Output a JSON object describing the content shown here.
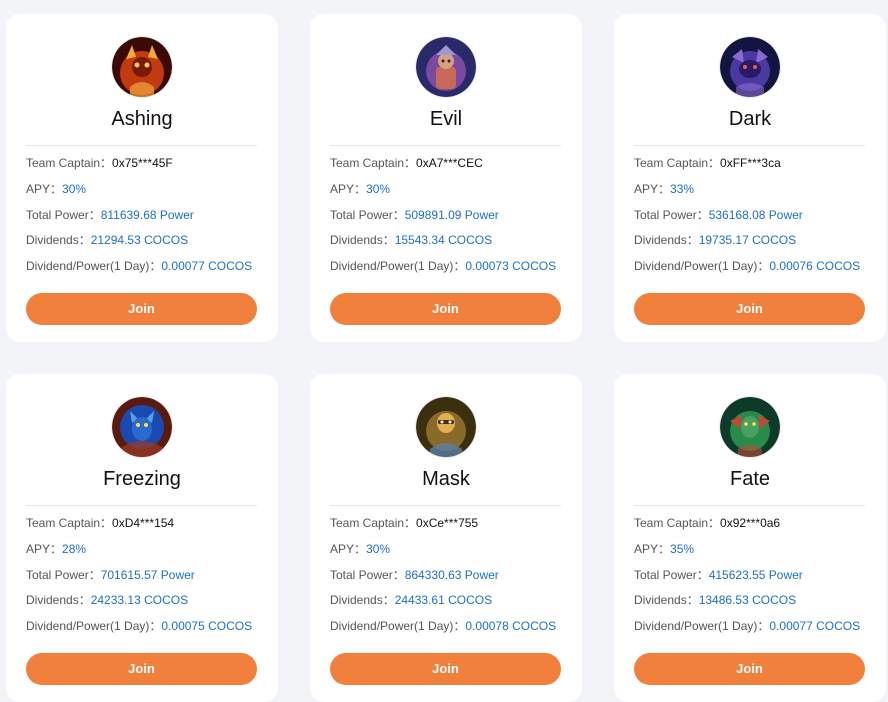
{
  "labels": {
    "captain": "Team Captain：",
    "apy": "APY：",
    "power": "Total Power：",
    "dividends": "Dividends：",
    "dividend_per_power": "Dividend/Power(1 Day)："
  },
  "colors": {
    "accent": "#f0803c",
    "value_blue": "#1f6fc4",
    "background": "#f3f4f7",
    "card": "#ffffff"
  },
  "teams": [
    {
      "name": "Ashing",
      "captain": "0x75***45F",
      "apy": "30%",
      "power": "811639.68 Power",
      "dividends": "21294.53 COCOS",
      "dividend_per_power": "0.00077 COCOS",
      "join_label": "Join",
      "avatar_icon": "fire-demon-icon",
      "avatar_colors": [
        "#3a0a05",
        "#c23a10",
        "#f2a640"
      ]
    },
    {
      "name": "Evil",
      "captain": "0xA7***CEC",
      "apy": "30%",
      "power": "509891.09 Power",
      "dividends": "15543.34 COCOS",
      "dividend_per_power": "0.00073 COCOS",
      "join_label": "Join",
      "avatar_icon": "warlord-icon",
      "avatar_colors": [
        "#2a2a6a",
        "#7a4aa0",
        "#c86a5a"
      ]
    },
    {
      "name": "Dark",
      "captain": "0xFF***3ca",
      "apy": "33%",
      "power": "536168.08 Power",
      "dividends": "19735.17 COCOS",
      "dividend_per_power": "0.00076 COCOS",
      "join_label": "Join",
      "avatar_icon": "dark-beast-icon",
      "avatar_colors": [
        "#141440",
        "#4a3aa0",
        "#8a6ad0"
      ]
    },
    {
      "name": "Freezing",
      "captain": "0xD4***154",
      "apy": "28%",
      "power": "701615.57 Power",
      "dividends": "24233.13 COCOS",
      "dividend_per_power": "0.00075 COCOS",
      "join_label": "Join",
      "avatar_icon": "ice-dragon-icon",
      "avatar_colors": [
        "#5a1a10",
        "#1a4ab0",
        "#5aa0e8"
      ]
    },
    {
      "name": "Mask",
      "captain": "0xCe***755",
      "apy": "30%",
      "power": "864330.63 Power",
      "dividends": "24433.61 COCOS",
      "dividend_per_power": "0.00078 COCOS",
      "join_label": "Join",
      "avatar_icon": "masked-warrior-icon",
      "avatar_colors": [
        "#3a3010",
        "#8a6a2a",
        "#e0b050"
      ]
    },
    {
      "name": "Fate",
      "captain": "0x92***0a6",
      "apy": "35%",
      "power": "415623.55 Power",
      "dividends": "13486.53 COCOS",
      "dividend_per_power": "0.00077 COCOS",
      "join_label": "Join",
      "avatar_icon": "green-dragon-icon",
      "avatar_colors": [
        "#0e3a2a",
        "#2a8a4a",
        "#c04a3a"
      ]
    }
  ]
}
